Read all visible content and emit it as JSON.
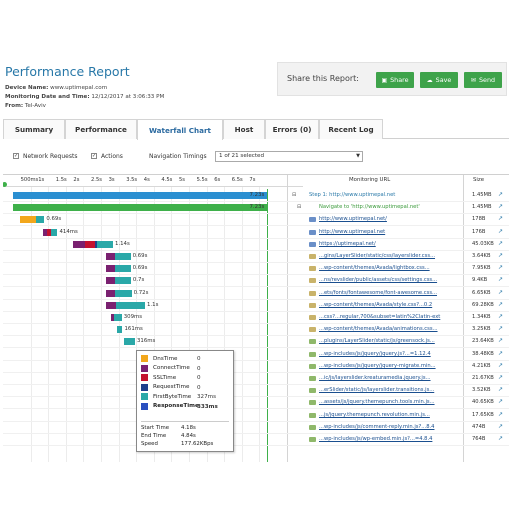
{
  "header": {
    "title": "Performance Report",
    "device_label": "Device Name:",
    "device_value": "www.uptimepal.com",
    "datetime_label": "Monitoring Date and Time:",
    "datetime_value": "12/12/2017 at 3:06:33 PM",
    "from_label": "From:",
    "from_value": "Tel-Aviv"
  },
  "share": {
    "label": "Share this Report:",
    "share_button": "Share",
    "save_button": "Save",
    "send_button": "Send"
  },
  "tabs": [
    "Summary",
    "Performance",
    "Waterfall Chart",
    "Host",
    "Errors (0)",
    "Recent Log"
  ],
  "active_tab": "Waterfall Chart",
  "toolbar": {
    "network_requests": "Network Requests",
    "actions": "Actions",
    "nav_timings_label": "Navigation Timings",
    "nav_timings_value": "1 of 21 selected"
  },
  "columns": {
    "url": "Monitoring URL",
    "size": "Size"
  },
  "ticks": [
    "500ms",
    "1s",
    "1.5s",
    "2s",
    "2.5s",
    "3s",
    "3.5s",
    "4s",
    "4.5s",
    "5s",
    "5.5s",
    "6s",
    "6.5s",
    "7s"
  ],
  "colors": {
    "dns": "#f2a71c",
    "connect": "#7a2170",
    "ssl": "#c4122f",
    "request": "#1e3f8c",
    "first_byte": "#2aa8a8",
    "response": "#2a4fbf",
    "step": "#2b8fd1",
    "nav": "#3eb04a"
  },
  "chart_data": {
    "type": "bar",
    "x_unit": "s",
    "xlim": [
      0,
      7.4
    ],
    "bars": [
      {
        "label": "7.23s",
        "start": 0,
        "duration": 7.23,
        "kind": "step"
      },
      {
        "label": "7.23s",
        "start": 0,
        "duration": 7.23,
        "kind": "nav"
      },
      {
        "label": "0.69s",
        "start": 0.2,
        "duration": 0.69
      },
      {
        "label": "414ms",
        "start": 0.85,
        "duration": 0.414
      },
      {
        "label": "1.14s",
        "start": 1.7,
        "duration": 1.14
      },
      {
        "label": "0.69s",
        "start": 2.65,
        "duration": 0.69
      },
      {
        "label": "0.69s",
        "start": 2.65,
        "duration": 0.69
      },
      {
        "label": "0.7s",
        "start": 2.65,
        "duration": 0.7
      },
      {
        "label": "0.72s",
        "start": 2.65,
        "duration": 0.72
      },
      {
        "label": "1.1s",
        "start": 2.65,
        "duration": 1.1
      },
      {
        "label": "309ms",
        "start": 2.78,
        "duration": 0.309
      },
      {
        "label": "161ms",
        "start": 2.95,
        "duration": 0.161
      },
      {
        "label": "316ms",
        "start": 3.15,
        "duration": 0.316
      }
    ]
  },
  "rows": [
    {
      "url": "Step 1: http://www.uptimepal.net",
      "size": "1.45MB",
      "type": "step"
    },
    {
      "url": "Navigate to 'http://www.uptimepal.net'",
      "size": "1.45MB",
      "type": "nav"
    },
    {
      "url": "http://www.uptimepal.net/",
      "size": "178B",
      "type": "page"
    },
    {
      "url": "http://www.uptimepal.net",
      "size": "176B",
      "type": "page"
    },
    {
      "url": "https://uptimepal.net/",
      "size": "45.03KB",
      "type": "page"
    },
    {
      "url": "...gins/LayerSlider/static/css/layerslider.css...",
      "size": "3.64KB",
      "type": "css"
    },
    {
      "url": "...wp-content/themes/Avada/lightbox.css...",
      "size": "7.95KB",
      "type": "css"
    },
    {
      "url": "...ns/revslider/public/assets/css/settings.css...",
      "size": "9.4KB",
      "type": "css"
    },
    {
      "url": "...ets/fonts/fontawesome/font-awesome.css...",
      "size": "6.65KB",
      "type": "css"
    },
    {
      "url": "...wp-content/themes/Avada/style.css?...0.2",
      "size": "69.28KB",
      "type": "css"
    },
    {
      "url": "...css?...regular,700&subset=latin%2Clatin-ext",
      "size": "1.34KB",
      "type": "css"
    },
    {
      "url": "...wp-content/themes/Avada/animations.css...",
      "size": "3.25KB",
      "type": "css"
    },
    {
      "url": "...plugins/LayerSlider/static/js/greensock.js...",
      "size": "23.64KB",
      "type": "js"
    },
    {
      "url": "...wp-includes/js/jquery/jquery.js?...=1.12.4",
      "size": "38.48KB",
      "type": "js"
    },
    {
      "url": "...wp-includes/js/jquery/jquery-migrate.min...",
      "size": "4.21KB",
      "type": "js"
    },
    {
      "url": "...ic/js/layerslider.kreaturamedia.jquery.js...",
      "size": "21.67KB",
      "type": "js"
    },
    {
      "url": "...erSlider/static/js/layerslider.transitions.js...",
      "size": "3.52KB",
      "type": "js"
    },
    {
      "url": "...assets/js/jquery.themepunch.tools.min.js...",
      "size": "40.65KB",
      "type": "js"
    },
    {
      "url": "...js/jquery.themepunch.revolution.min.js...",
      "size": "17.65KB",
      "type": "js"
    },
    {
      "url": "...wp-includes/js/comment-reply.min.js?...8.4",
      "size": "474B",
      "type": "js"
    },
    {
      "url": "...wp-includes/js/wp-embed.min.js?...=4.8.4",
      "size": "764B",
      "type": "js"
    }
  ],
  "tooltip": {
    "items": [
      {
        "name": "DnsTime",
        "value": "0",
        "color": "#f2a71c"
      },
      {
        "name": "ConnectTime",
        "value": "0",
        "color": "#7a2170"
      },
      {
        "name": "SSLTime",
        "value": "0",
        "color": "#c4122f"
      },
      {
        "name": "RequestTime",
        "value": "0",
        "color": "#1e3f8c"
      },
      {
        "name": "FirstByteTime",
        "value": "327ms",
        "color": "#2aa8a8"
      },
      {
        "name": "ResponseTime",
        "value": "333ms",
        "color": "#2a4fbf",
        "bold": true
      }
    ],
    "start_label": "Start Time",
    "start_value": "4.18s",
    "end_label": "End Time",
    "end_value": "4.84s",
    "speed_label": "Speed",
    "speed_value": "177.62KBps"
  }
}
